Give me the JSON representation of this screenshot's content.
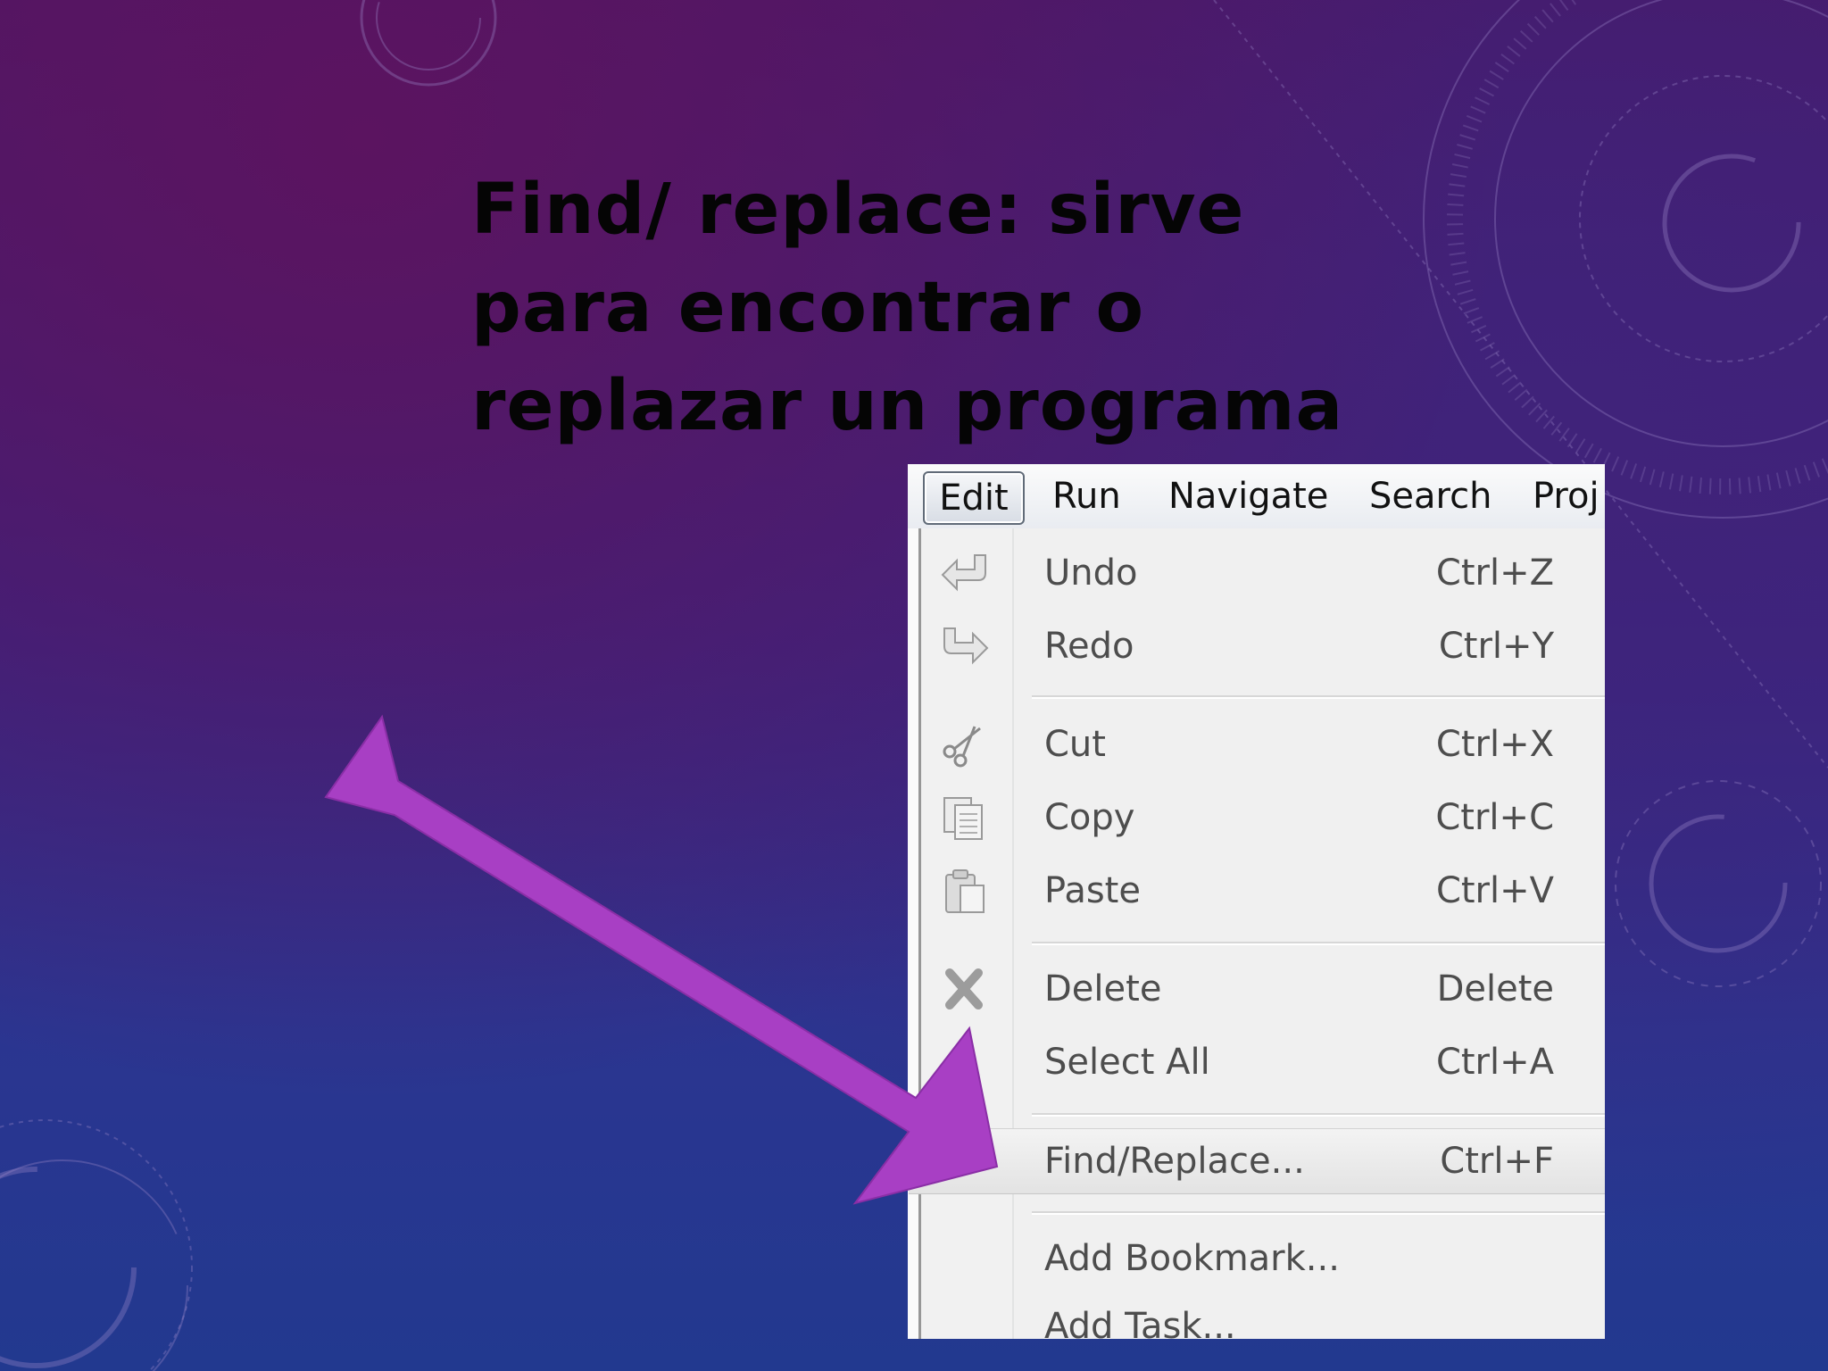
{
  "slide": {
    "title_lines": [
      "Find/ replace: sirve",
      "para encontrar o",
      "replazar un programa"
    ]
  },
  "menubar": {
    "items": [
      "Edit",
      "Run",
      "Navigate",
      "Search",
      "Proj"
    ]
  },
  "edit_menu": {
    "items": [
      {
        "label": "Undo",
        "shortcut": "Ctrl+Z",
        "icon": "undo-icon"
      },
      {
        "label": "Redo",
        "shortcut": "Ctrl+Y",
        "icon": "redo-icon"
      },
      {
        "label": "Cut",
        "shortcut": "Ctrl+X",
        "icon": "scissors-icon"
      },
      {
        "label": "Copy",
        "shortcut": "Ctrl+C",
        "icon": "copy-icon"
      },
      {
        "label": "Paste",
        "shortcut": "Ctrl+V",
        "icon": "paste-icon"
      },
      {
        "label": "Delete",
        "shortcut": "Delete",
        "icon": "delete-icon"
      },
      {
        "label": "Select All",
        "shortcut": "Ctrl+A",
        "icon": ""
      },
      {
        "label": "Find/Replace...",
        "shortcut": "Ctrl+F",
        "icon": "",
        "highlighted": true
      },
      {
        "label": "Add Bookmark...",
        "shortcut": "",
        "icon": ""
      },
      {
        "label": "Add Task...",
        "shortcut": "",
        "icon": ""
      }
    ]
  },
  "colors": {
    "arrow": "#a83fc4",
    "title": "#050505",
    "background_top": "#4a1766",
    "background_bottom": "#22398f"
  }
}
